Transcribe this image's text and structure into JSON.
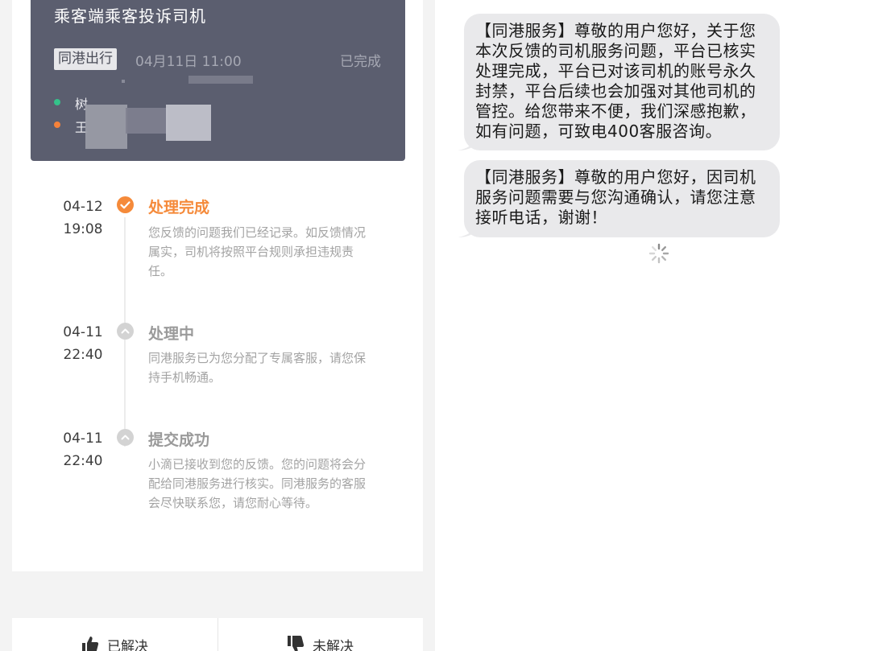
{
  "left_panel": {
    "order": {
      "title": "乘客端乘客投诉司机",
      "brand": "同港出行",
      "time": "04月11日 11:00",
      "status": "已完成",
      "start_label": "树",
      "end_label": "王"
    },
    "timeline": [
      {
        "date": "04-12",
        "time": "19:08",
        "title": "处理完成",
        "desc": "您反馈的问题我们已经记录。如反馈情况属实，司机将按照平台规则承担违规责任。",
        "state": "done",
        "title_color": "#f58a3a"
      },
      {
        "date": "04-11",
        "time": "22:40",
        "title": "处理中",
        "desc": "同港服务已为您分配了专属客服，请您保持手机畅通。",
        "state": "pending",
        "title_color": "#9a9a9a"
      },
      {
        "date": "04-11",
        "time": "22:40",
        "title": "提交成功",
        "desc": "小滴已接收到您的反馈。您的问题将会分配给同港服务进行核实。同港服务的客服会尽快联系您，请您耐心等待。",
        "state": "pending",
        "title_color": "#9a9a9a"
      }
    ],
    "footer": {
      "solved_label": "已解决",
      "unsolved_label": "未解决"
    }
  },
  "right_panel": {
    "messages": [
      {
        "text": "【同港服务】尊敬的用户您好，关于您本次反馈的司机服务问题，平台已核实处理完成，平台已对该司机的账号永久封禁，平台后续也会加强对其他司机的管控。给您带来不便，我们深感抱歉，如有问题，可致电400客服咨询。"
      },
      {
        "text": "【同港服务】尊敬的用户您好，因司机服务问题需要与您沟通确认，请您注意接听电话，谢谢！"
      }
    ]
  },
  "colors": {
    "accent": "#f58a3a",
    "card_bg": "#5b5e6f",
    "bubble_bg": "#e9e9eb",
    "start_dot": "#34c28a",
    "end_dot": "#f5823a"
  },
  "icons": {
    "check": "check-icon",
    "chevron": "chevron-up-icon",
    "thumb_up": "thumbs-up-icon",
    "thumb_down": "thumbs-down-icon",
    "spinner": "loading-spinner-icon"
  }
}
